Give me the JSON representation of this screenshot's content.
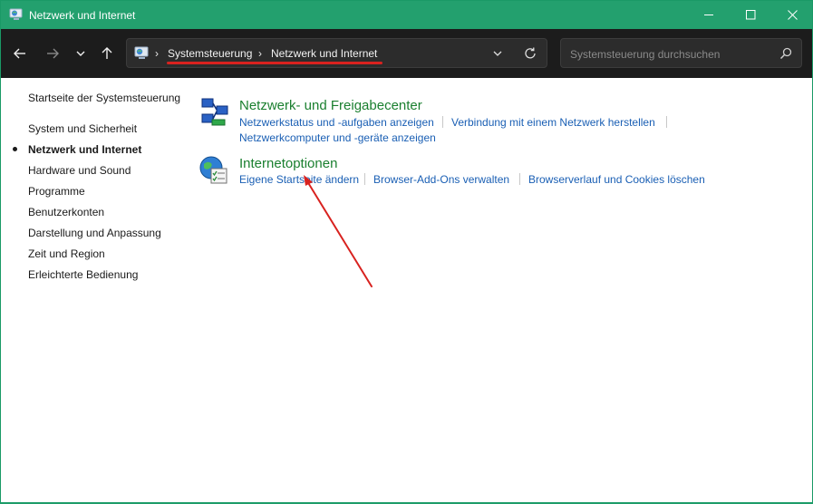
{
  "window": {
    "title": "Netzwerk und Internet"
  },
  "toolbar": {
    "breadcrumbs": [
      "Systemsteuerung",
      "Netzwerk und Internet"
    ],
    "search_placeholder": "Systemsteuerung durchsuchen"
  },
  "sidebar": {
    "home": "Startseite der Systemsteuerung",
    "items": [
      {
        "label": "System und Sicherheit",
        "active": false
      },
      {
        "label": "Netzwerk und Internet",
        "active": true
      },
      {
        "label": "Hardware und Sound",
        "active": false
      },
      {
        "label": "Programme",
        "active": false
      },
      {
        "label": "Benutzerkonten",
        "active": false
      },
      {
        "label": "Darstellung und Anpassung",
        "active": false
      },
      {
        "label": "Zeit und Region",
        "active": false
      },
      {
        "label": "Erleichterte Bedienung",
        "active": false
      }
    ]
  },
  "main": {
    "categories": [
      {
        "title": "Netzwerk- und Freigabecenter",
        "icon": "network-sharing-icon",
        "links": [
          "Netzwerkstatus und -aufgaben anzeigen",
          "Verbindung mit einem Netzwerk herstellen",
          "Netzwerkcomputer und -geräte anzeigen"
        ]
      },
      {
        "title": "Internetoptionen",
        "icon": "internet-options-icon",
        "links": [
          "Eigene Startseite ändern",
          "Browser-Add-Ons verwalten",
          "Browserverlauf und Cookies löschen"
        ]
      }
    ]
  },
  "colors": {
    "titlebar": "#23a06e",
    "toolbar": "#1c1c1c",
    "category_title": "#1a7f2f",
    "link": "#1a5fb4",
    "annotation": "#d8221f"
  }
}
